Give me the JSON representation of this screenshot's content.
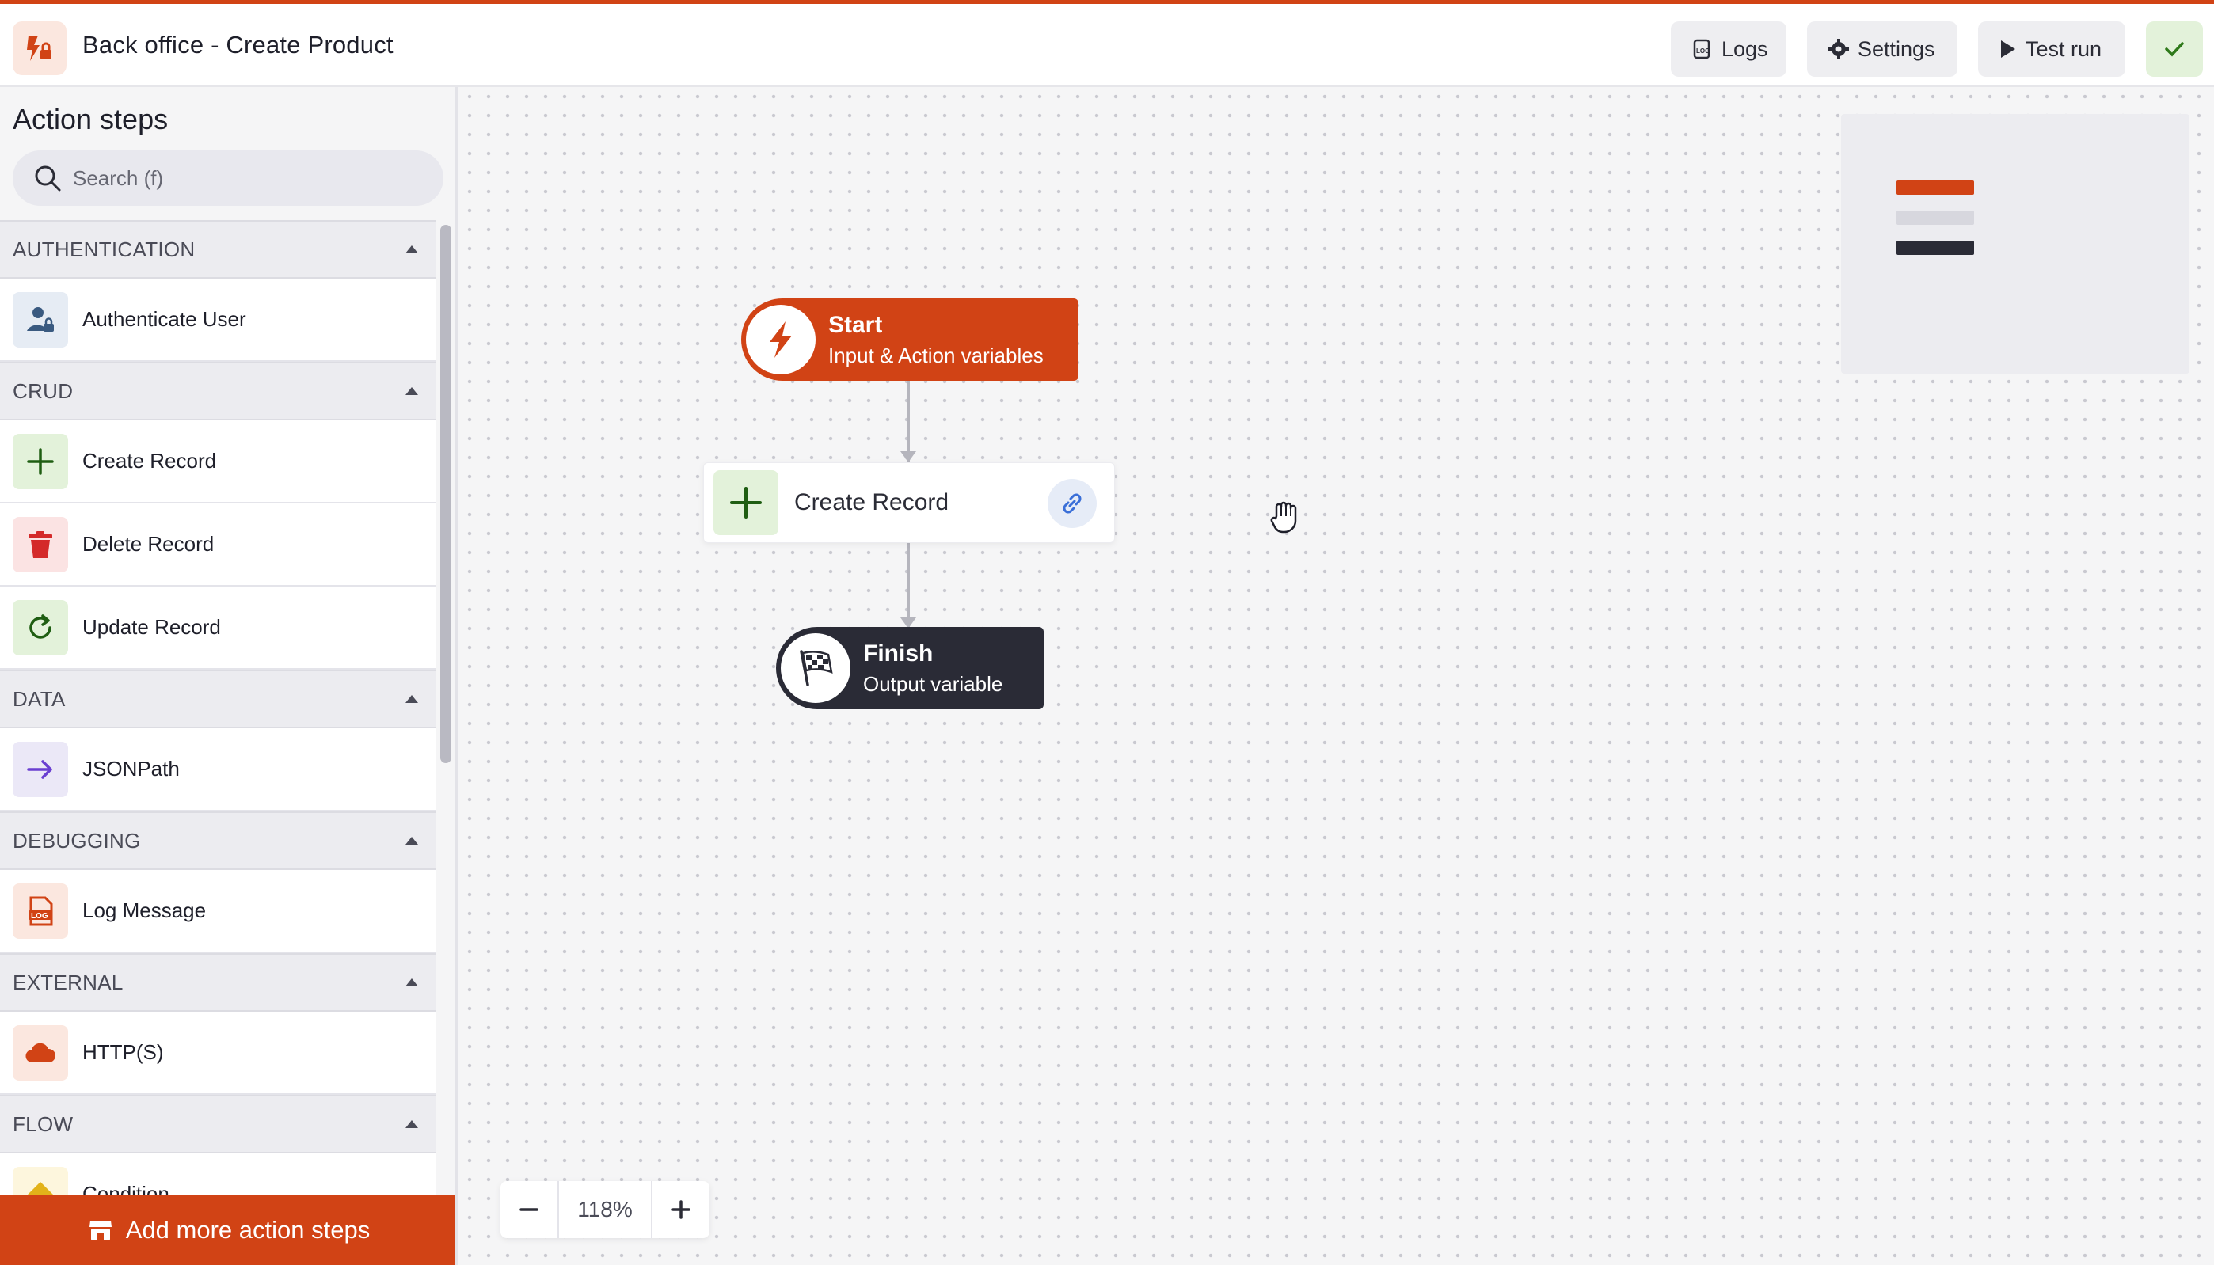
{
  "header": {
    "title": "Back office - Create Product",
    "logs_label": "Logs",
    "settings_label": "Settings",
    "testrun_label": "Test run"
  },
  "sidebar": {
    "title": "Action steps",
    "search_placeholder": "Search (f)",
    "sections": [
      {
        "label": "AUTHENTICATION",
        "items": [
          {
            "label": "Authenticate User",
            "icon": "user-lock-icon"
          }
        ]
      },
      {
        "label": "CRUD",
        "items": [
          {
            "label": "Create Record",
            "icon": "plus-icon"
          },
          {
            "label": "Delete Record",
            "icon": "trash-icon"
          },
          {
            "label": "Update Record",
            "icon": "refresh-icon"
          }
        ]
      },
      {
        "label": "DATA",
        "items": [
          {
            "label": "JSONPath",
            "icon": "arrow-right-icon"
          }
        ]
      },
      {
        "label": "DEBUGGING",
        "items": [
          {
            "label": "Log Message",
            "icon": "log-file-icon"
          }
        ]
      },
      {
        "label": "EXTERNAL",
        "items": [
          {
            "label": "HTTP(S)",
            "icon": "cloud-icon"
          }
        ]
      },
      {
        "label": "FLOW",
        "items": [
          {
            "label": "Condition",
            "icon": "diamond-icon"
          }
        ]
      }
    ],
    "add_label": "Add more action steps"
  },
  "canvas": {
    "start": {
      "title": "Start",
      "subtitle": "Input & Action variables"
    },
    "create": {
      "label": "Create Record"
    },
    "finish": {
      "title": "Finish",
      "subtitle": "Output variable"
    },
    "zoom": "118%"
  },
  "colors": {
    "accent": "#d14315",
    "dark": "#2a2b36",
    "success_bg": "#e3f2da",
    "success": "#2f7a1a"
  }
}
